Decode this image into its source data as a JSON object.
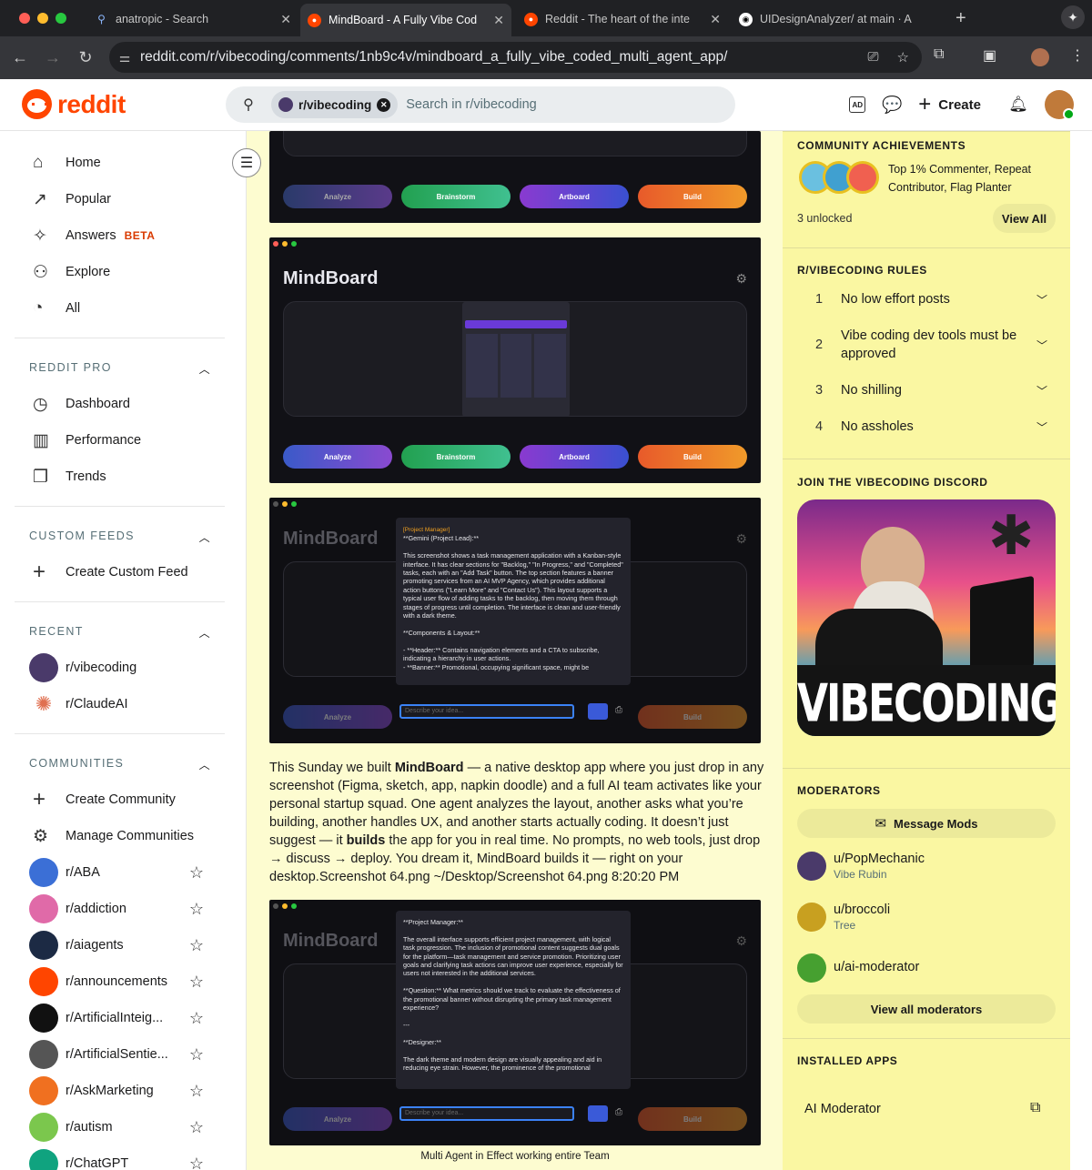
{
  "browser": {
    "tabs": [
      {
        "title": "anatropic - Search",
        "icon": "search-icon"
      },
      {
        "title": "MindBoard - A Fully Vibe Cod",
        "icon": "reddit-icon",
        "active": true
      },
      {
        "title": "Reddit - The heart of the inte",
        "icon": "reddit-icon"
      },
      {
        "title": "UIDesignAnalyzer/ at main · A",
        "icon": "github-icon"
      }
    ],
    "url": "reddit.com/r/vibecoding/comments/1nb9c4v/mindboard_a_fully_vibe_coded_multi_agent_app/"
  },
  "header": {
    "logo_text": "reddit",
    "search_chip": "r/vibecoding",
    "search_placeholder": "Search in r/vibecoding",
    "create_label": "Create"
  },
  "sidebar": {
    "nav": [
      {
        "label": "Home",
        "icon": "home-icon",
        "glyph": "⌂"
      },
      {
        "label": "Popular",
        "icon": "popular-icon",
        "glyph": "↗"
      },
      {
        "label": "Answers",
        "icon": "answers-icon",
        "glyph": "✧",
        "badge": "BETA"
      },
      {
        "label": "Explore",
        "icon": "explore-icon",
        "glyph": "⚇"
      },
      {
        "label": "All",
        "icon": "all-icon",
        "glyph": "◔"
      }
    ],
    "pro_heading": "REDDIT PRO",
    "pro": [
      {
        "label": "Dashboard",
        "glyph": "◷"
      },
      {
        "label": "Performance",
        "glyph": "▥"
      },
      {
        "label": "Trends",
        "glyph": "❐"
      }
    ],
    "feeds_heading": "CUSTOM FEEDS",
    "create_feed": "Create Custom Feed",
    "recent_heading": "RECENT",
    "recent": [
      {
        "label": "r/vibecoding",
        "color": "#4a3a6a"
      },
      {
        "label": "r/ClaudeAI",
        "color": "#e07050"
      }
    ],
    "communities_heading": "COMMUNITIES",
    "create_community": "Create Community",
    "manage_communities": "Manage Communities",
    "communities": [
      {
        "label": "r/ABA",
        "color": "#3b6fd6"
      },
      {
        "label": "r/addiction",
        "color": "#e06aa8"
      },
      {
        "label": "r/aiagents",
        "color": "#1c2a44"
      },
      {
        "label": "r/announcements",
        "color": "#ff4500"
      },
      {
        "label": "r/ArtificialInteig...",
        "color": "#111111"
      },
      {
        "label": "r/ArtificialSentie...",
        "color": "#555555"
      },
      {
        "label": "r/AskMarketing",
        "color": "#f07020"
      },
      {
        "label": "r/autism",
        "color": "#7bc74d"
      },
      {
        "label": "r/ChatGPT",
        "color": "#10a37f"
      }
    ]
  },
  "post": {
    "panel_title": "MindBoard",
    "buttons": [
      "Analyze",
      "Brainstorm",
      "Artboard",
      "Build"
    ],
    "overlay1": {
      "role": "[Project Manager]",
      "text": "**Gemini (Project Lead):**\n\nThis screenshot shows a task management application with a Kanban-style interface. It has clear sections for \"Backlog,\" \"In Progress,\" and \"Completed\" tasks, each with an \"Add Task\" button. The top section features a banner promoting services from an AI MVP Agency, which provides additional action buttons (\"Learn More\" and \"Contact Us\"). This layout supports a typical user flow of adding tasks to the backlog, then moving them through stages of progress until completion. The interface is clean and user-friendly with a dark theme.\n\n**Components & Layout:**\n\n- **Header:** Contains navigation elements and a CTA to subscribe, indicating a hierarchy in user actions.\n- **Banner:** Promotional, occupying significant space, might be"
    },
    "overlay2": {
      "text": "**Project Manager:**\n\nThe overall interface supports efficient project management, with logical task progression. The inclusion of promotional content suggests dual goals for the platform—task management and service promotion. Prioritizing user goals and clarifying task actions can improve user experience, especially for users not interested in the additional services.\n\n**Question:** What metrics should we track to evaluate the effectiveness of the promotional banner without disrupting the primary task management experience?\n\n---\n\n**Designer:**\n\nThe dark theme and modern design are visually appealing and aid in reducing eye strain. However, the prominence of the promotional"
    },
    "input_placeholder": "Describe your idea...",
    "body_before": "This Sunday we built ",
    "body_bold1": "MindBoard",
    "body_mid": " — a native desktop app where you just drop in any screenshot (Figma, sketch, app, napkin doodle) and a full AI team activates like your personal startup squad. One agent analyzes the layout, another asks what you’re building, another handles UX, and another starts actually coding. It doesn’t just suggest — it ",
    "body_bold2": "builds",
    "body_after": " the app for you in real time. No prompts, no web tools, just drop → discuss → deploy. You dream it, MindBoard builds it — right on your desktop.Screenshot 64.png ~/Desktop/Screenshot 64.png 8:20:20 PM",
    "caption": "Multi Agent in Effect working entire Team"
  },
  "right": {
    "achievements_heading": "COMMUNITY ACHIEVEMENTS",
    "achievements_text": "Top 1% Commenter, Repeat Contributor, Flag Planter",
    "unlocked": "3 unlocked",
    "view_all": "View All",
    "rules_heading": "R/VIBECODING RULES",
    "rules": [
      {
        "n": "1",
        "text": "No low effort posts"
      },
      {
        "n": "2",
        "text": "Vibe coding dev tools must be approved"
      },
      {
        "n": "3",
        "text": "No shilling"
      },
      {
        "n": "4",
        "text": "No assholes"
      }
    ],
    "discord_heading": "JOIN THE VIBECODING DISCORD",
    "discord_banner_text": "VIBECODING",
    "moderators_heading": "MODERATORS",
    "message_mods": "Message Mods",
    "moderators": [
      {
        "name": "u/PopMechanic",
        "flair": "Vibe Rubin",
        "color": "#4a3a6a"
      },
      {
        "name": "u/broccoli",
        "flair": "Tree",
        "color": "#c8a020"
      },
      {
        "name": "u/ai-moderator",
        "flair": "",
        "color": "#46a030"
      }
    ],
    "view_all_mods": "View all moderators",
    "installed_heading": "INSTALLED APPS",
    "installed_app": "AI Moderator"
  },
  "colors": {
    "reddit_orange": "#ff4500",
    "main_bg": "#fdfcd0",
    "right_bg": "#faf7a2",
    "btn_analyze": "#4a4fc8",
    "btn_brainstorm": "#2fb06a",
    "btn_artboard": "#7a4fd6",
    "btn_build": "#e8702a"
  }
}
